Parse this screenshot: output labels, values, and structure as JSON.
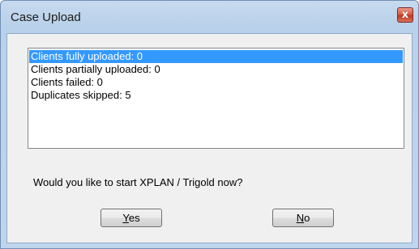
{
  "window": {
    "title": "Case Upload",
    "close_glyph": "x"
  },
  "list": {
    "items": [
      {
        "text": "Clients fully uploaded: 0",
        "selected": true
      },
      {
        "text": "Clients partially uploaded: 0",
        "selected": false
      },
      {
        "text": "Clients failed: 0",
        "selected": false
      },
      {
        "text": "Duplicates skipped: 5",
        "selected": false
      }
    ]
  },
  "prompt": "Would you like to start XPLAN / Trigold now?",
  "buttons": {
    "yes": {
      "mnemonic": "Y",
      "rest": "es"
    },
    "no": {
      "mnemonic": "N",
      "rest": "o"
    }
  },
  "colors": {
    "selection": "#3399ff",
    "titlebar": "#b9d1ea",
    "close_button": "#c2381f"
  }
}
